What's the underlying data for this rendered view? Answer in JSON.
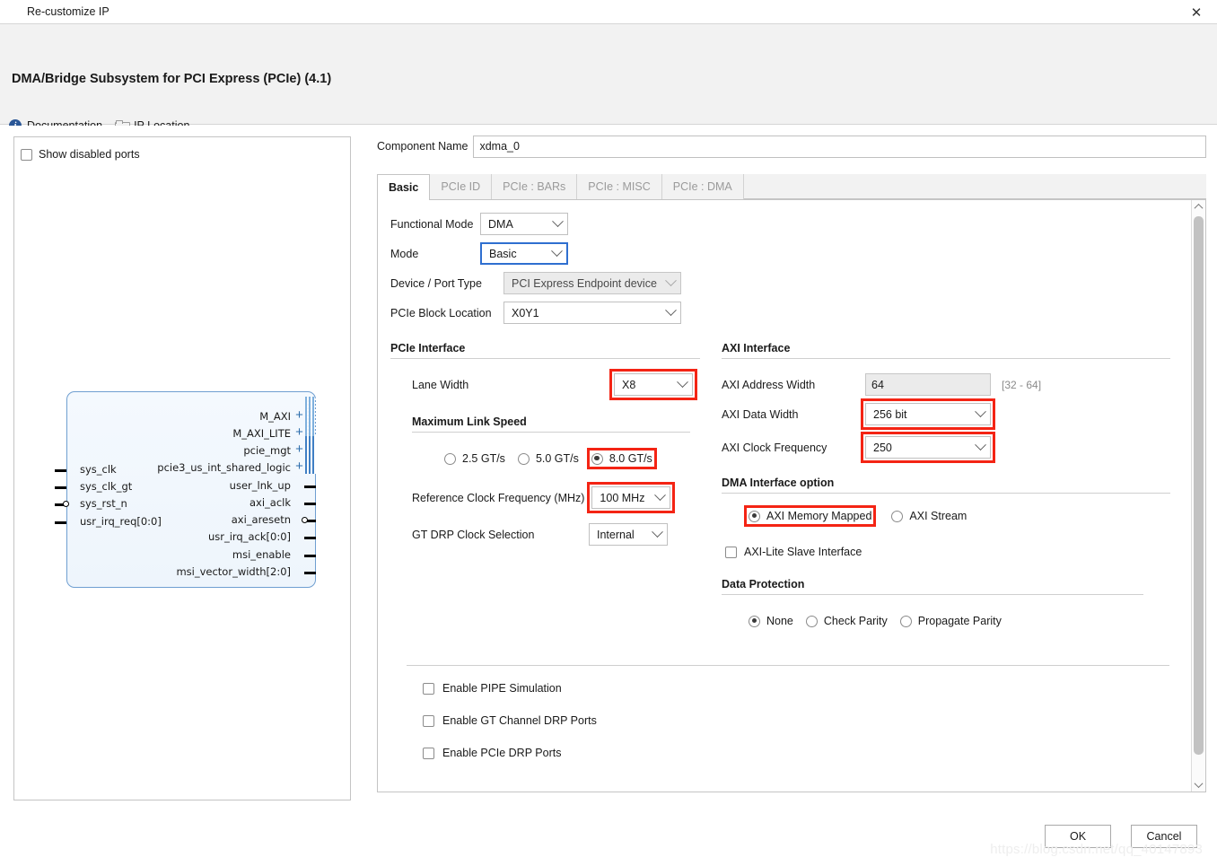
{
  "window": {
    "title": "Re-customize IP",
    "close_label": "✕",
    "app_icon": "xilinx-logo-icon"
  },
  "header": {
    "ip_title": "DMA/Bridge Subsystem for PCI Express (PCIe) (4.1)",
    "links": [
      {
        "label": "Documentation",
        "icon": "info-icon"
      },
      {
        "label": "IP Location",
        "icon": "folder-icon"
      }
    ],
    "brand_logo": "xilinx-logo-icon"
  },
  "diagram": {
    "show_disabled_ports": {
      "label": "Show disabled ports",
      "checked": false
    },
    "left_ports": [
      {
        "name": "sys_clk",
        "type": "pin"
      },
      {
        "name": "sys_clk_gt",
        "type": "pin"
      },
      {
        "name": "sys_rst_n",
        "type": "pin-inverted"
      },
      {
        "name": "usr_irq_req[0:0]",
        "type": "pin"
      }
    ],
    "right_ports": [
      {
        "name": "M_AXI",
        "type": "bus"
      },
      {
        "name": "M_AXI_LITE",
        "type": "bus"
      },
      {
        "name": "pcie_mgt",
        "type": "bus"
      },
      {
        "name": "pcie3_us_int_shared_logic",
        "type": "bus"
      },
      {
        "name": "user_lnk_up",
        "type": "pin"
      },
      {
        "name": "axi_aclk",
        "type": "pin"
      },
      {
        "name": "axi_aresetn",
        "type": "pin-inverted"
      },
      {
        "name": "usr_irq_ack[0:0]",
        "type": "pin"
      },
      {
        "name": "msi_enable",
        "type": "pin"
      },
      {
        "name": "msi_vector_width[2:0]",
        "type": "pin"
      }
    ]
  },
  "component": {
    "label": "Component Name",
    "value": "xdma_0"
  },
  "tabs": [
    {
      "label": "Basic",
      "active": true
    },
    {
      "label": "PCIe ID",
      "active": false
    },
    {
      "label": "PCIe : BARs",
      "active": false
    },
    {
      "label": "PCIe : MISC",
      "active": false
    },
    {
      "label": "PCIe : DMA",
      "active": false
    }
  ],
  "basic": {
    "functional_mode": {
      "label": "Functional Mode",
      "value": "DMA"
    },
    "mode": {
      "label": "Mode",
      "value": "Basic",
      "focused": true
    },
    "device_port_type": {
      "label": "Device / Port Type",
      "value": "PCI Express Endpoint device",
      "disabled": true
    },
    "pcie_block_location": {
      "label": "PCIe Block Location",
      "value": "X0Y1"
    }
  },
  "pcie_interface": {
    "title": "PCIe Interface",
    "lane_width": {
      "label": "Lane Width",
      "value": "X8",
      "highlighted": true
    },
    "max_link_speed": {
      "title": "Maximum Link Speed",
      "options": [
        {
          "label": "2.5 GT/s",
          "selected": false,
          "highlighted": false
        },
        {
          "label": "5.0 GT/s",
          "selected": false,
          "highlighted": false
        },
        {
          "label": "8.0 GT/s",
          "selected": true,
          "highlighted": true
        }
      ]
    },
    "ref_clock_freq": {
      "label": "Reference Clock Frequency (MHz)",
      "value": "100 MHz",
      "highlighted": true
    },
    "gt_drp_clock": {
      "label": "GT DRP Clock Selection",
      "value": "Internal",
      "highlighted": false
    }
  },
  "axi_interface": {
    "title": "AXI Interface",
    "axi_address_width": {
      "label": "AXI Address Width",
      "value": "64",
      "hint": "[32 - 64]",
      "disabled": true
    },
    "axi_data_width": {
      "label": "AXI Data Width",
      "value": "256 bit",
      "highlighted": true
    },
    "axi_clock_freq": {
      "label": "AXI Clock Frequency",
      "value": "250",
      "highlighted": true
    },
    "dma_interface_option": {
      "title": "DMA Interface option",
      "options": [
        {
          "label": "AXI Memory Mapped",
          "selected": true,
          "highlighted": true
        },
        {
          "label": "AXI Stream",
          "selected": false,
          "highlighted": false
        }
      ]
    },
    "axi_lite_slave": {
      "label": "AXI-Lite Slave Interface",
      "checked": false
    },
    "data_protection": {
      "title": "Data Protection",
      "options": [
        {
          "label": "None",
          "selected": true
        },
        {
          "label": "Check Parity",
          "selected": false
        },
        {
          "label": "Propagate Parity",
          "selected": false
        }
      ]
    }
  },
  "bottom_options": [
    {
      "label": "Enable PIPE Simulation",
      "checked": false
    },
    {
      "label": "Enable GT Channel DRP Ports",
      "checked": false
    },
    {
      "label": "Enable PCIe DRP Ports",
      "checked": false
    }
  ],
  "buttons": {
    "ok": "OK",
    "cancel": "Cancel"
  },
  "watermark": "https://blog.csdn.net/qq_40147893"
}
